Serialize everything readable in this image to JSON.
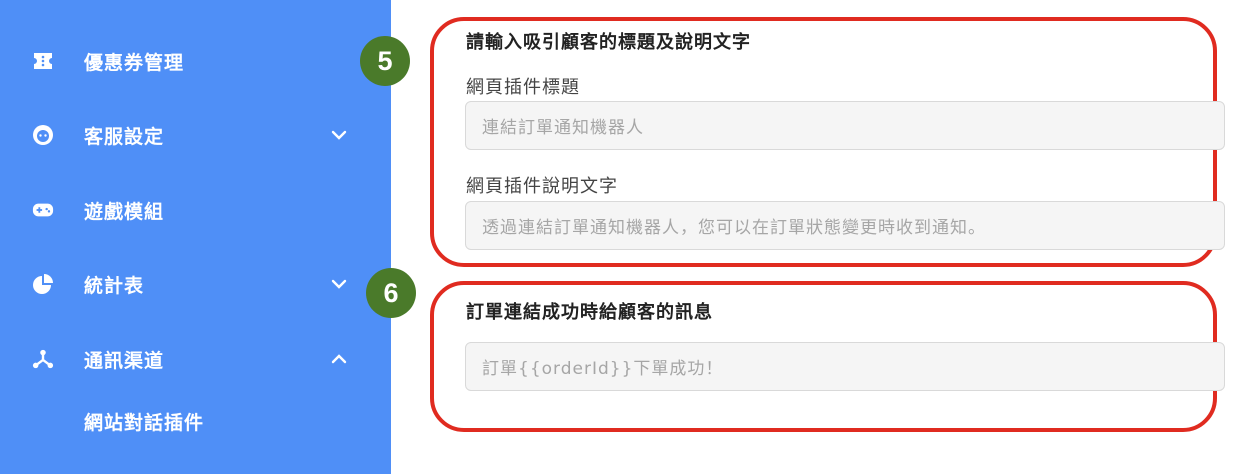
{
  "sidebar": {
    "items": [
      {
        "label": "優惠券管理",
        "icon": "ticket-icon"
      },
      {
        "label": "客服設定",
        "icon": "headset-icon",
        "chevron": "down"
      },
      {
        "label": "遊戲模組",
        "icon": "gamepad-icon"
      },
      {
        "label": "統計表",
        "icon": "pie-chart-icon",
        "chevron": "down"
      },
      {
        "label": "通訊渠道",
        "icon": "channels-icon",
        "chevron": "up"
      }
    ],
    "sub_item": "網站對話插件",
    "bg_color": "#4f8ff7"
  },
  "step_badges": [
    "5",
    "6"
  ],
  "section5": {
    "title": "請輸入吸引顧客的標題及說明文字",
    "widget_title_label": "網頁插件標題",
    "widget_title_placeholder": "連結訂單通知機器人",
    "widget_desc_label": "網頁插件說明文字",
    "widget_desc_placeholder": "透過連結訂單通知機器人，您可以在訂單狀態變更時收到通知。"
  },
  "section6": {
    "title": "訂單連結成功時給顧客的訊息",
    "message_placeholder": "訂單{{orderId}}下單成功！"
  },
  "colors": {
    "highlight": "#e02b20",
    "badge": "#4a7a2a"
  }
}
